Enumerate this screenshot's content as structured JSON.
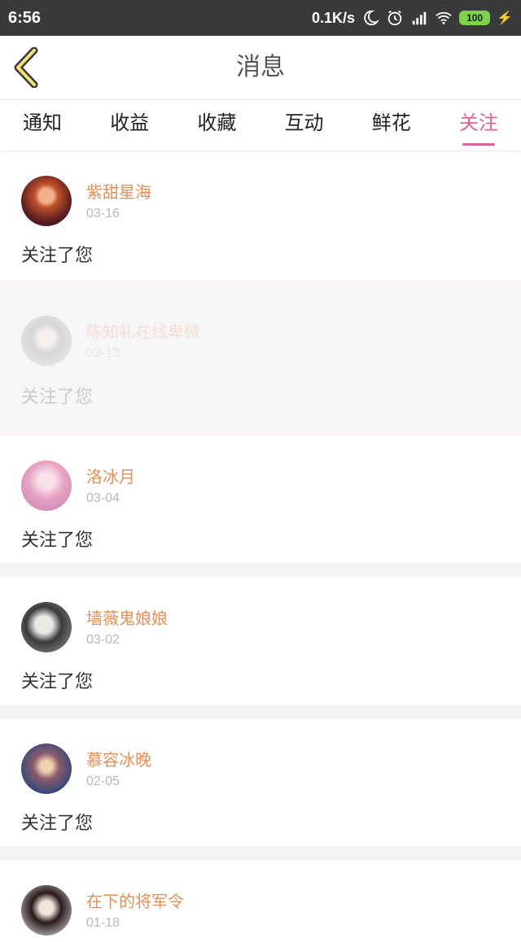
{
  "status": {
    "time": "6:56",
    "speed": "0.1K/s",
    "battery": "100"
  },
  "header": {
    "title": "消息"
  },
  "tabs": [
    {
      "label": "通知"
    },
    {
      "label": "收益"
    },
    {
      "label": "收藏"
    },
    {
      "label": "互动"
    },
    {
      "label": "鲜花"
    },
    {
      "label": "关注",
      "active": true
    }
  ],
  "items": [
    {
      "name": "紫甜星海",
      "date": "03-16",
      "message": "关注了您",
      "avatar_color": "#8a3a2a"
    },
    {
      "name": "陈知礼在线卑微",
      "date": "03-13",
      "message": "关注了您",
      "avatar_color": "#8a8a8a"
    },
    {
      "name": "洛冰月",
      "date": "03-04",
      "message": "关注了您",
      "avatar_color": "#e8a4c4"
    },
    {
      "name": "墙薇鬼娘娘",
      "date": "03-02",
      "message": "关注了您",
      "avatar_color": "#6a6a6a"
    },
    {
      "name": "慕容冰晚",
      "date": "02-05",
      "message": "关注了您",
      "avatar_color": "#5a6a8a"
    },
    {
      "name": "在下的将军令",
      "date": "01-18",
      "message": "",
      "avatar_color": "#3a2a2a"
    }
  ],
  "colors": {
    "accent": "#e0609e",
    "name": "#e0905a"
  }
}
